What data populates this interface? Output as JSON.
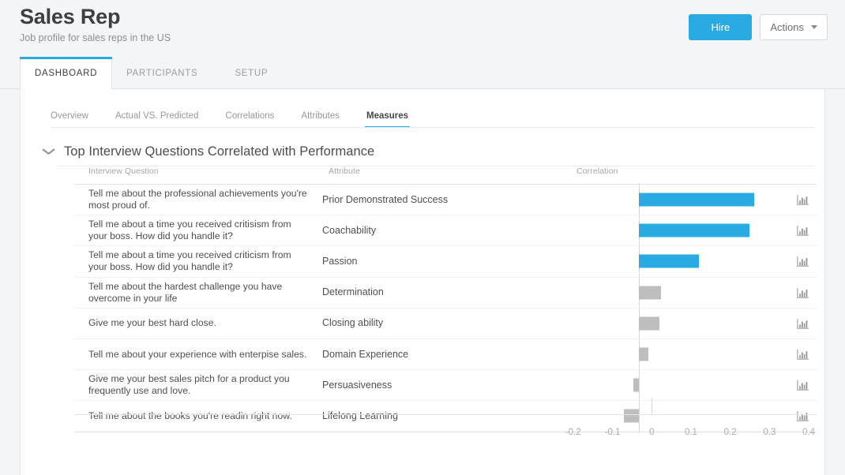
{
  "header": {
    "title": "Sales Rep",
    "subtitle": "Job profile for sales reps in the US",
    "hire_label": "Hire",
    "actions_label": "Actions"
  },
  "tabs": [
    {
      "label": "DASHBOARD",
      "active": true
    },
    {
      "label": "PARTICIPANTS",
      "active": false
    },
    {
      "label": "SETUP",
      "active": false
    }
  ],
  "subtabs": [
    {
      "label": "Overview",
      "active": false
    },
    {
      "label": "Actual VS. Predicted",
      "active": false
    },
    {
      "label": "Correlations",
      "active": false
    },
    {
      "label": "Attributes",
      "active": false
    },
    {
      "label": "Measures",
      "active": true
    }
  ],
  "section": {
    "title": "Top Interview Questions Correlated with Performance",
    "collapse_icon": "chevron-down-icon"
  },
  "table": {
    "columns": [
      "Interview Question",
      "Attribute",
      "Correlation"
    ],
    "row_icon": "bar-chart-icon"
  },
  "colors": {
    "accent": "#29abe2",
    "positive_bar": "#29abe2",
    "neutral_bar": "#bcbec0",
    "page_bg": "#f4f5f6",
    "card_bg": "#ffffff"
  },
  "chart_data": {
    "type": "bar",
    "orientation": "horizontal",
    "title": "Top Interview Questions Correlated with Performance",
    "xlabel": "Correlation",
    "ylabel": "Attribute",
    "xlim": [
      -0.24,
      0.42
    ],
    "xticks": [
      -0.2,
      -0.1,
      0,
      0.1,
      0.2,
      0.3,
      0.4
    ],
    "xtick_labels": [
      "-0.2",
      "-0.1",
      "0",
      "0.1",
      "0.2",
      "0.3",
      "0.4"
    ],
    "grid": false,
    "legend": "none",
    "zero_reference_line": true,
    "categories": [
      "Prior Demonstrated Success",
      "Coachability",
      "Passion",
      "Determination",
      "Closing ability",
      "Domain Experience",
      "Persuasiveness",
      "Lifelong Learning"
    ],
    "values": [
      0.293,
      0.281,
      0.152,
      0.056,
      0.051,
      0.023,
      -0.014,
      -0.039
    ],
    "bar_colors": [
      "#29abe2",
      "#29abe2",
      "#29abe2",
      "#bcbec0",
      "#bcbec0",
      "#bcbec0",
      "#bcbec0",
      "#bcbec0"
    ]
  },
  "rows": [
    {
      "question": "Tell me about the professional achievements you're most proud of.",
      "attribute": "Prior Demonstrated Success",
      "correlation": 0.293
    },
    {
      "question": "Tell me about a time you received critisism from your boss. How did you handle it?",
      "attribute": "Coachability",
      "correlation": 0.281
    },
    {
      "question": "Tell me about a time you received criticism from your boss. How did you handle it?",
      "attribute": "Passion",
      "correlation": 0.152
    },
    {
      "question": "Tell me about the hardest challenge you have overcome in your life",
      "attribute": "Determination",
      "correlation": 0.056
    },
    {
      "question": "Give me your best hard close.",
      "attribute": "Closing ability",
      "correlation": 0.051
    },
    {
      "question": "Tell me about your experience with enterpise sales.",
      "attribute": "Domain Experience",
      "correlation": 0.023
    },
    {
      "question": "Give me your best sales pitch for a product you frequently use and love.",
      "attribute": "Persuasiveness",
      "correlation": -0.014
    },
    {
      "question": "Tell me about the books you're readin right now.",
      "attribute": "Lifelong Learning",
      "correlation": -0.039
    }
  ]
}
